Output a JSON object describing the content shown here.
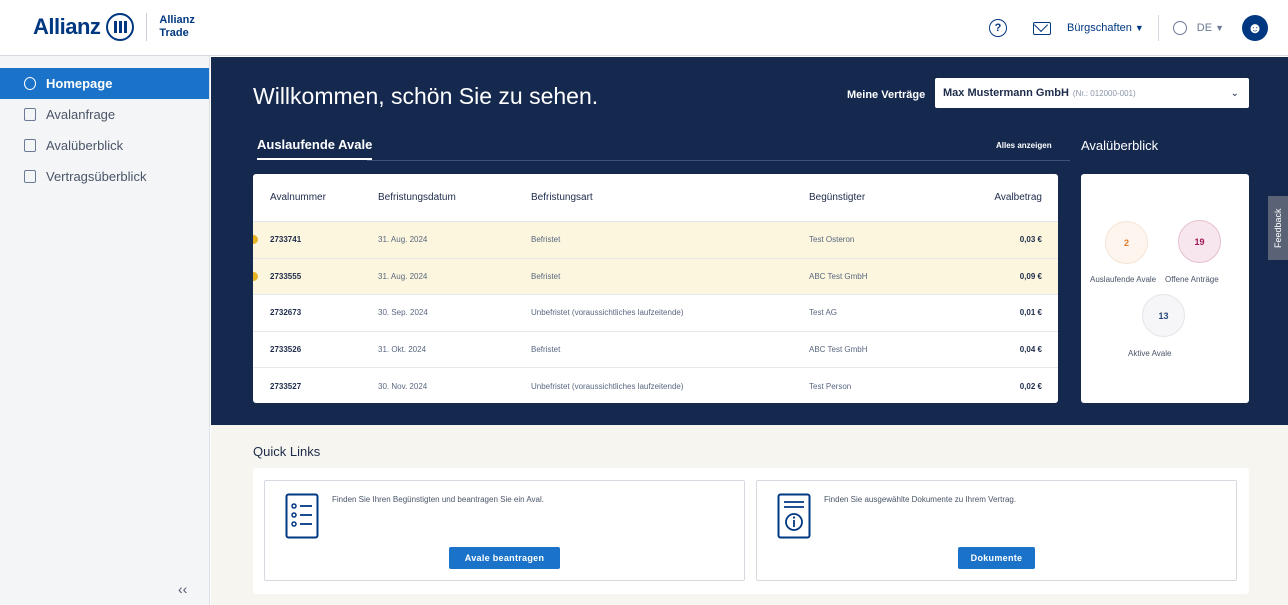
{
  "header": {
    "brand": "Allianz",
    "brand_sub_line1": "Allianz",
    "brand_sub_line2": "Trade",
    "help_icon_text": "?",
    "menu_label": "Bürgschaften",
    "language": "DE",
    "avatar_glyph": "Ω"
  },
  "sidebar": {
    "items": [
      {
        "label": "Homepage",
        "icon": "dashboard-icon",
        "active": true
      },
      {
        "label": "Avalanfrage",
        "icon": "form-icon"
      },
      {
        "label": "Avalüberblick",
        "icon": "folder-icon"
      },
      {
        "label": "Vertragsüberblick",
        "icon": "contract-icon"
      }
    ],
    "collapse_label": "‹‹"
  },
  "hero": {
    "welcome": "Willkommen, schön Sie zu sehen.",
    "contract_label": "Meine Verträge",
    "contract_name": "Max Mustermann GmbH",
    "contract_nr": "(Nr.: 012000-001)",
    "tab_label": "Auslaufende Avale",
    "show_all": "Alles anzeigen",
    "overview_title": "Avalüberblick"
  },
  "table": {
    "headers": [
      "Avalnummer",
      "Befristungsdatum",
      "Befristungsart",
      "Begünstigter",
      "Avalbetrag"
    ],
    "rows": [
      {
        "nr": "2733741",
        "date": "31. Aug. 2024",
        "type": "Befristet",
        "beneficiary": "Test Osteron",
        "amount": "0,03 €",
        "warn": true
      },
      {
        "nr": "2733555",
        "date": "31. Aug. 2024",
        "type": "Befristet",
        "beneficiary": "ABC Test GmbH",
        "amount": "0,09 €",
        "warn": true
      },
      {
        "nr": "2732673",
        "date": "30. Sep. 2024",
        "type": "Unbefristet (voraussichtliches laufzeitende)",
        "beneficiary": "Test AG",
        "amount": "0,01 €",
        "warn": false
      },
      {
        "nr": "2733526",
        "date": "31. Okt. 2024",
        "type": "Befristet",
        "beneficiary": "ABC Test GmbH",
        "amount": "0,04 €",
        "warn": false
      },
      {
        "nr": "2733527",
        "date": "30. Nov. 2024",
        "type": "Unbefristet (voraussichtliches laufzeitende)",
        "beneficiary": "Test Person",
        "amount": "0,02 €",
        "warn": false
      }
    ]
  },
  "stats": {
    "expiring_count": "2",
    "expiring_label": "Auslaufende Avale",
    "open_count": "19",
    "open_label": "Offene Anträge",
    "active_count": "13",
    "active_label": "Aktive Avale"
  },
  "feedback_label": "Feedback",
  "quick_links": {
    "title": "Quick Links",
    "cards": [
      {
        "text": "Finden Sie Ihren Begünstigten und beantragen Sie ein Aval.",
        "button": "Avale beantragen",
        "icon": "list-icon"
      },
      {
        "text": "Finden Sie ausgewählte Dokumente zu Ihrem Vertrag.",
        "button": "Dokumente",
        "icon": "document-info-icon"
      }
    ]
  },
  "colors": {
    "primary": "#003781",
    "hero_bg": "#15294f",
    "accent_button": "#1a73c9",
    "warning": "#e6b323"
  }
}
